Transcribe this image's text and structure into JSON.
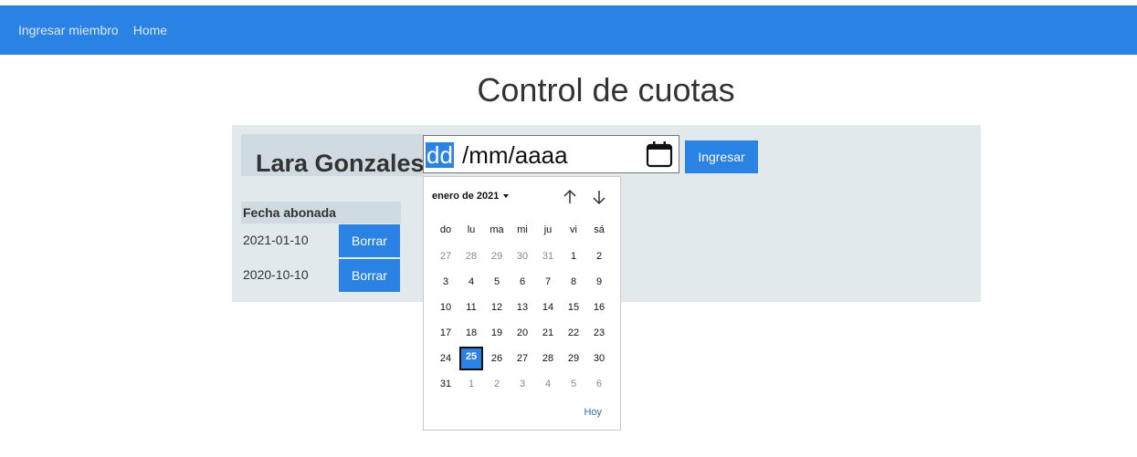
{
  "nav": {
    "items": [
      {
        "label": "Ingresar miembro"
      },
      {
        "label": "Home"
      }
    ],
    "bg_color": "#2a82e4"
  },
  "page": {
    "title": "Control de cuotas"
  },
  "member": {
    "name": "Lara Gonzales"
  },
  "date_input": {
    "segment_day": "dd",
    "segment_rest": "/mm/aaaa",
    "icon": "calendar-icon"
  },
  "submit_label": "Ingresar",
  "table": {
    "header": "Fecha abonada",
    "rows": [
      {
        "date": "2021-01-10",
        "delete_label": "Borrar"
      },
      {
        "date": "2020-10-10",
        "delete_label": "Borrar"
      }
    ]
  },
  "calendar": {
    "month_label": "enero de 2021",
    "weekdays": [
      "do",
      "lu",
      "ma",
      "mi",
      "ju",
      "vi",
      "sá"
    ],
    "weeks": [
      [
        "27",
        "28",
        "29",
        "30",
        "31",
        "1",
        "2"
      ],
      [
        "3",
        "4",
        "5",
        "6",
        "7",
        "8",
        "9"
      ],
      [
        "10",
        "11",
        "12",
        "13",
        "14",
        "15",
        "16"
      ],
      [
        "17",
        "18",
        "19",
        "20",
        "21",
        "22",
        "23"
      ],
      [
        "24",
        "25",
        "26",
        "27",
        "28",
        "29",
        "30"
      ],
      [
        "31",
        "1",
        "2",
        "3",
        "4",
        "5",
        "6"
      ]
    ],
    "other_month": [
      [
        true,
        true,
        true,
        true,
        true,
        false,
        false
      ],
      [
        false,
        false,
        false,
        false,
        false,
        false,
        false
      ],
      [
        false,
        false,
        false,
        false,
        false,
        false,
        false
      ],
      [
        false,
        false,
        false,
        false,
        false,
        false,
        false
      ],
      [
        false,
        false,
        false,
        false,
        false,
        false,
        false
      ],
      [
        false,
        true,
        true,
        true,
        true,
        true,
        true
      ]
    ],
    "selected_day": "25",
    "today_label": "Hoy"
  }
}
